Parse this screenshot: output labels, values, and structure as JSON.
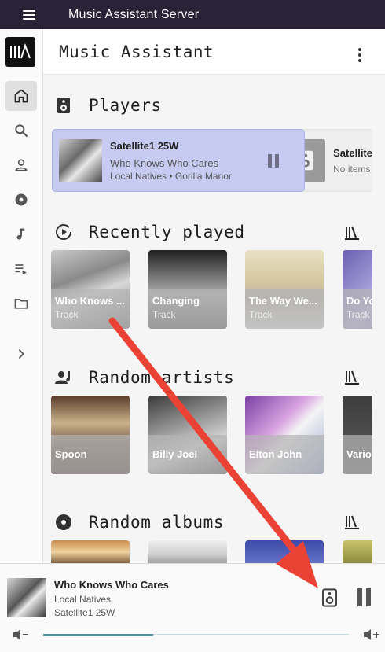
{
  "appbar": {
    "title": "Music Assistant Server"
  },
  "header": {
    "title": "Music Assistant"
  },
  "nav": [
    "home-icon",
    "search-icon",
    "person-icon",
    "album-icon",
    "music-note-icon",
    "playlist-icon",
    "folder-icon",
    "chevron-right-icon"
  ],
  "sections": {
    "players": "Players",
    "recent": "Recently played",
    "artists": "Random artists",
    "albums": "Random albums"
  },
  "players": [
    {
      "name": "Satellite1 25W",
      "track": "Who Knows Who Cares",
      "artist_album": "Local Natives • Gorilla Manor"
    },
    {
      "name": "Satellite",
      "sub": "No items"
    }
  ],
  "recent": [
    {
      "title": "Who Knows ...",
      "type": "Track"
    },
    {
      "title": "Changing",
      "type": "Track"
    },
    {
      "title": "The Way We...",
      "type": "Track"
    },
    {
      "title": "Do Yo",
      "type": "Track"
    }
  ],
  "artists": [
    {
      "name": "Spoon"
    },
    {
      "name": "Billy Joel"
    },
    {
      "name": "Elton John"
    },
    {
      "name": "Vario"
    }
  ],
  "now_playing": {
    "title": "Who Knows Who Cares",
    "artist": "Local Natives",
    "player": "Satellite1 25W",
    "progress": 0.36
  },
  "colors": {
    "appbar": "#2a2236",
    "active_player": "#c7cbf2",
    "progress": "#4a95a4",
    "arrow": "#ea4335"
  }
}
